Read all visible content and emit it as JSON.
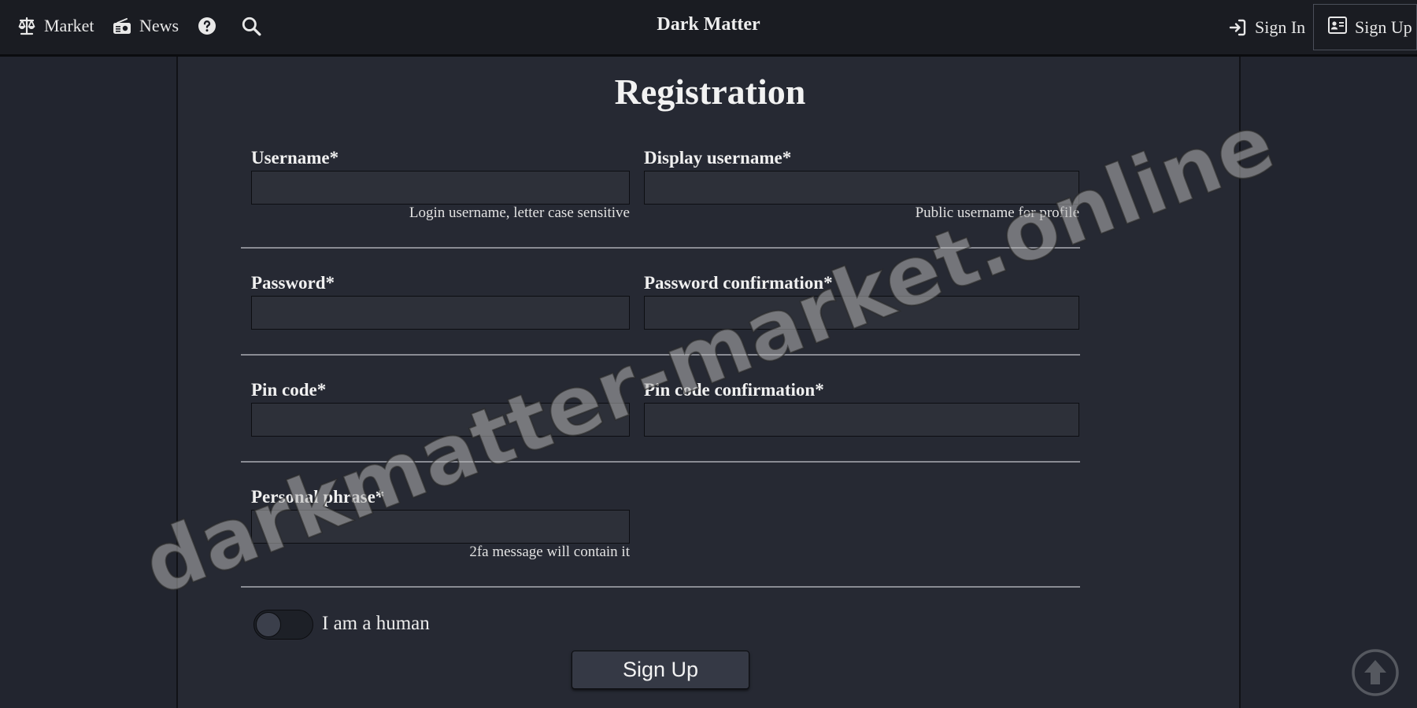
{
  "nav": {
    "market_label": "Market",
    "market_icon": "scale-icon",
    "news_label": "News",
    "news_icon": "radio-icon",
    "help_icon": "question-circle-icon",
    "search_icon": "search-icon",
    "brand": "Dark Matter",
    "signin_label": "Sign In",
    "signin_icon": "sign-in-icon",
    "signup_label": "Sign Up",
    "signup_icon": "id-card-icon"
  },
  "form": {
    "title": "Registration",
    "username": {
      "label": "Username*",
      "value": "",
      "hint": "Login username, letter case sensitive"
    },
    "display_username": {
      "label": "Display username*",
      "value": "",
      "hint": "Public username for profile"
    },
    "password": {
      "label": "Password*",
      "value": ""
    },
    "password_confirmation": {
      "label": "Password confirmation*",
      "value": ""
    },
    "pin_code": {
      "label": "Pin code*",
      "value": ""
    },
    "pin_code_confirmation": {
      "label": "Pin code confirmation*",
      "value": ""
    },
    "personal_phrase": {
      "label": "Personal phrase*",
      "value": "",
      "hint": "2fa message will contain it"
    },
    "human_toggle": {
      "label": "I am a human",
      "checked": false
    },
    "submit_label": "Sign Up"
  },
  "scroll_top_icon": "arrow-up-circle-icon",
  "watermark": "darkmatter-market.online",
  "colors": {
    "background": "#22252f",
    "navbar": "#1a1c22",
    "panel": "#262933",
    "input": "#2d3039",
    "text": "#e6e6e6"
  }
}
